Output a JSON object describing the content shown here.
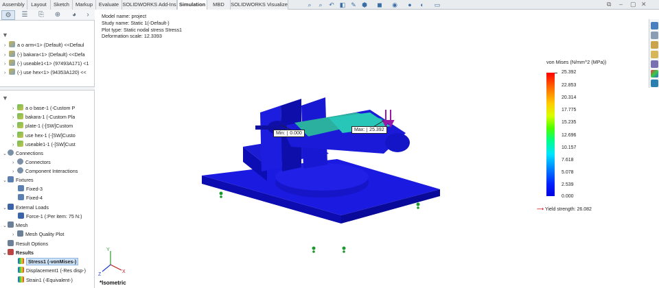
{
  "tabs": [
    "Assembly",
    "Layout",
    "Sketch",
    "Markup",
    "Evaluate",
    "SOLIDWORKS Add-Ins",
    "Simulation",
    "MBD",
    "SOLIDWORKS Visualize"
  ],
  "active_tab": "Simulation",
  "top_tree": [
    {
      "label": "a o arm<1> (Default) <<Defaul",
      "icon": "part-icon"
    },
    {
      "label": "(-) bakara<1> (Default) <<Defa",
      "icon": "part-icon"
    },
    {
      "label": "(-) useable1<1> (97493A171) <1",
      "icon": "part-icon"
    },
    {
      "label": "(-) use hex<1> (94353A120) <<",
      "icon": "part-icon"
    }
  ],
  "sim_tree": {
    "parts": [
      "a o base-1 (-Custom P",
      "bakara-1 (-Custom Pla",
      "plate-1 (-[SW]Custom",
      "use hex-1 (-[SW]Custo",
      "useable1-1 (-[SW]Cust"
    ],
    "connections": "Connections",
    "connectors": "Connectors",
    "component_interactions": "Component Interactions",
    "fixtures": "Fixtures",
    "fixed3": "Fixed-3",
    "fixed4": "Fixed-4",
    "external_loads": "External Loads",
    "force1": "Force-1 (:Per item: 75 N:)",
    "mesh": "Mesh",
    "mesh_quality": "Mesh Quality Plot",
    "result_options": "Result Options",
    "results": "Results",
    "stress1": "Stress1 (-vonMises-)",
    "displacement1": "Displacement1 (-Res disp-)",
    "strain1": "Strain1 (-Equivalent-)"
  },
  "info": {
    "model_name": "Model name: project",
    "study_name": "Study name: Static 1(-Default-)",
    "plot_type": "Plot type: Static nodal stress Stress1",
    "deformation": "Deformation scale: 12.3393"
  },
  "legend": {
    "title": "von Mises (N/mm^2 (MPa))",
    "values": [
      "25.392",
      "22.853",
      "20.314",
      "17.775",
      "15.235",
      "12.696",
      "10.157",
      "7.618",
      "5.078",
      "2.539",
      "0.000"
    ],
    "yield": "Yield strength: 26.082"
  },
  "probes": {
    "min_label": "Min:",
    "min_value": "0.000",
    "max_label": "Max:",
    "max_value": "25.392"
  },
  "view_label": "*Isometric",
  "colors": {
    "model_blue": "#1010d8",
    "legend_top": "#ff0000",
    "legend_bottom": "#0000e0",
    "yield_arrow": "#d01818",
    "selection": "#cde1f7"
  }
}
